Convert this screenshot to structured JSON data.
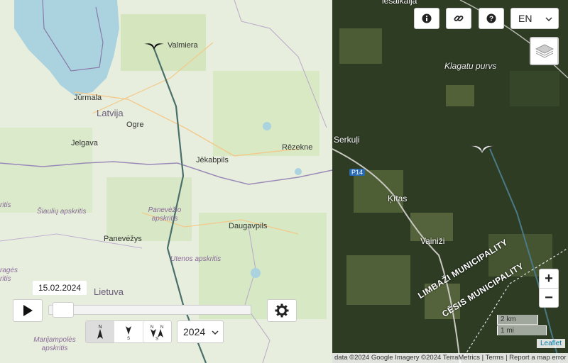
{
  "left_map": {
    "places": [
      {
        "id": "valmiera",
        "name": "Valmiera"
      },
      {
        "id": "jurmala",
        "name": "Jūrmala"
      },
      {
        "id": "latvija",
        "name": "Latvija"
      },
      {
        "id": "ogre",
        "name": "Ogre"
      },
      {
        "id": "jelgava",
        "name": "Jelgava"
      },
      {
        "id": "rezekne",
        "name": "Rēzekne"
      },
      {
        "id": "jekabpils",
        "name": "Jēkabpils"
      },
      {
        "id": "daugavpils",
        "name": "Daugavpils"
      },
      {
        "id": "panevezys",
        "name": "Panevėžys"
      },
      {
        "id": "lietuva",
        "name": "Lietuva"
      }
    ],
    "regions": [
      {
        "id": "siauliu",
        "name": "Šiaulių apskritis"
      },
      {
        "id": "panevezio",
        "name": "Panevėžio apskritis"
      },
      {
        "id": "utenos",
        "name": "Utenos apskritis"
      },
      {
        "id": "marijampoles",
        "name": "Marijampolės apskritis"
      },
      {
        "id": "tauragės",
        "name": "ragės"
      },
      {
        "id": "ritis_left",
        "name": "ritis"
      },
      {
        "id": "ritis_left2",
        "name": "ritis"
      }
    ]
  },
  "right_map": {
    "places": [
      {
        "id": "klagatu",
        "name": "Klagatu purvs"
      },
      {
        "id": "serkuli",
        "name": "Serkuļi"
      },
      {
        "id": "kitas",
        "name": "Ķītas"
      },
      {
        "id": "vainizi",
        "name": "Vainiži"
      },
      {
        "id": "top_cut",
        "name": "iesalkalja"
      }
    ],
    "road_label": "P14",
    "municipalities": [
      "LIMBAŽI MUNICIPALITY",
      "CĒSIS MUNICIPALITY"
    ],
    "scale": {
      "km": "2 km",
      "mi": "1 mi"
    },
    "attribution": "data ©2024 Google Imagery ©2024 TerraMetrics | Terms | Report a map error",
    "leaflet": "Leaflet"
  },
  "playback": {
    "date": "15.02.2024",
    "progress": 0.02,
    "year": "2024"
  },
  "toolbar": {
    "language": "EN",
    "zoom_in": "+",
    "zoom_out": "−"
  },
  "icons": {
    "info": "info-icon",
    "link": "link-icon",
    "help": "help-icon",
    "layers": "layers-icon",
    "play": "play-icon",
    "settings": "gear-icon"
  }
}
